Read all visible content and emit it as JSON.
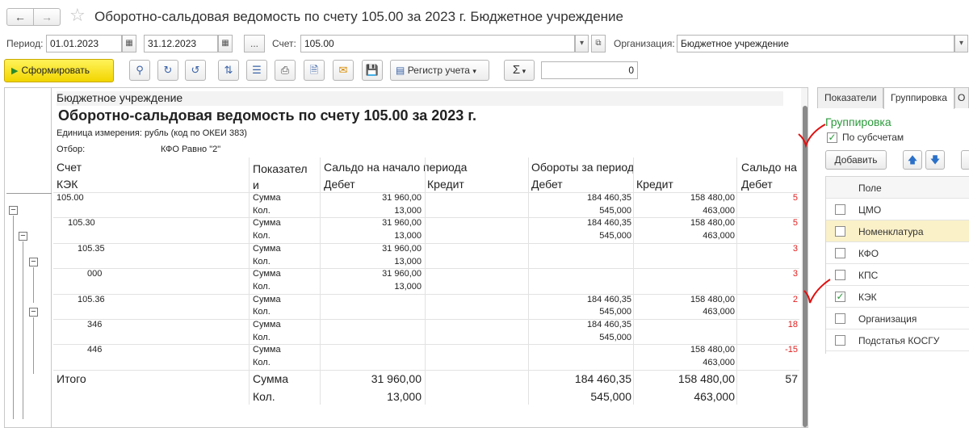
{
  "window": {
    "title": "Оборотно-сальдовая ведомость по счету 105.00 за 2023 г. Бюджетное учреждение",
    "back_icon": "arrow-left-icon",
    "forward_icon": "arrow-right-icon",
    "favorite_icon": "star-icon"
  },
  "params": {
    "period_label": "Период:",
    "date_from": "01.01.2023",
    "date_to": "31.12.2023",
    "more_btn": "...",
    "account_label": "Счет:",
    "account_value": "105.00",
    "org_label": "Организация:",
    "org_value": "Бюджетное учреждение"
  },
  "toolbar": {
    "generate_label": "Сформировать",
    "register_label": "Регистр учета",
    "sum_label": "Σ",
    "sum_value": "0"
  },
  "report": {
    "org": "Бюджетное учреждение",
    "title": "Оборотно-сальдовая ведомость по счету 105.00 за 2023 г.",
    "unit": "Единица измерения: рубль (код по ОКЕИ 383)",
    "filter_label": "Отбор:",
    "filter_value": "КФО Равно \"2\"",
    "headers": {
      "account": "Счет",
      "kek": "КЭК",
      "indicator": "Показател\nи",
      "opening": "Сальдо на начало периода",
      "turnover": "Обороты за период",
      "closing": "Сальдо на",
      "debit": "Дебет",
      "credit": "Кредит"
    },
    "rows": [
      {
        "label": "105.00",
        "indent": 0,
        "sum": {
          "ob_d": "31 960,00",
          "tr_d": "184 460,35",
          "tr_c": "158 480,00",
          "cl": "5"
        },
        "qty": {
          "ob_d": "13,000",
          "tr_d": "545,000",
          "tr_c": "463,000",
          "cl": ""
        }
      },
      {
        "label": "105.30",
        "indent": 1,
        "sum": {
          "ob_d": "31 960,00",
          "tr_d": "184 460,35",
          "tr_c": "158 480,00",
          "cl": "5"
        },
        "qty": {
          "ob_d": "13,000",
          "tr_d": "545,000",
          "tr_c": "463,000",
          "cl": ""
        }
      },
      {
        "label": "105.35",
        "indent": 2,
        "sum": {
          "ob_d": "31 960,00",
          "tr_d": "",
          "tr_c": "",
          "cl": "3"
        },
        "qty": {
          "ob_d": "13,000",
          "tr_d": "",
          "tr_c": "",
          "cl": ""
        }
      },
      {
        "label": "000",
        "indent": 3,
        "sum": {
          "ob_d": "31 960,00",
          "tr_d": "",
          "tr_c": "",
          "cl": "3"
        },
        "qty": {
          "ob_d": "13,000",
          "tr_d": "",
          "tr_c": "",
          "cl": ""
        }
      },
      {
        "label": "105.36",
        "indent": 2,
        "sum": {
          "ob_d": "",
          "tr_d": "184 460,35",
          "tr_c": "158 480,00",
          "cl": "2"
        },
        "qty": {
          "ob_d": "",
          "tr_d": "545,000",
          "tr_c": "463,000",
          "cl": ""
        }
      },
      {
        "label": "346",
        "indent": 3,
        "sum": {
          "ob_d": "",
          "tr_d": "184 460,35",
          "tr_c": "",
          "cl": "18"
        },
        "qty": {
          "ob_d": "",
          "tr_d": "545,000",
          "tr_c": "",
          "cl": ""
        }
      },
      {
        "label": "446",
        "indent": 3,
        "sum": {
          "ob_d": "",
          "tr_d": "",
          "tr_c": "158 480,00",
          "cl": "-15"
        },
        "qty": {
          "ob_d": "",
          "tr_d": "",
          "tr_c": "463,000",
          "cl": ""
        }
      }
    ],
    "sum_label": "Сумма",
    "qty_label": "Кол.",
    "total": {
      "label": "Итого",
      "sum_label": "Сумма",
      "qty_label": "Кол.",
      "sum_ob_d": "31 960,00",
      "sum_tr_d": "184 460,35",
      "sum_tr_c": "158 480,00",
      "sum_cl": "57",
      "qty_ob_d": "13,000",
      "qty_tr_d": "545,000",
      "qty_tr_c": "463,000"
    }
  },
  "panel": {
    "tabs": [
      "Показатели",
      "Группировка",
      "О"
    ],
    "active_tab": "Группировка",
    "group_title": "Группировка",
    "by_subaccounts": "По субсчетам",
    "add_btn": "Добавить",
    "field_header": "Поле",
    "fields": [
      {
        "label": "ЦМО",
        "checked": false
      },
      {
        "label": "Номенклатура",
        "checked": false
      },
      {
        "label": "КФО",
        "checked": false
      },
      {
        "label": "КПС",
        "checked": false
      },
      {
        "label": "КЭК",
        "checked": true
      },
      {
        "label": "Организация",
        "checked": false
      },
      {
        "label": "Подстатья КОСГУ",
        "checked": false
      }
    ]
  },
  "colors": {
    "accent_yellow": "#f2d500",
    "group_green": "#2b9a3b",
    "negative_red": "#e02020",
    "annotation_red": "#e01010"
  }
}
